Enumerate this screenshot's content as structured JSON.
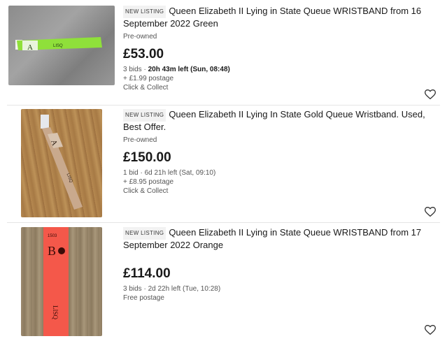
{
  "listings": [
    {
      "badge": "NEW LISTING",
      "title": "Queen Elizabeth II Lying in State Queue WRISTBAND from 16 September 2022  Green",
      "condition": "Pre-owned",
      "price": "£53.00",
      "bids": "3 bids · ",
      "time_left": "20h 43m left (Sun, 08:48)",
      "postage": "+ £1.99 postage",
      "collect": "Click & Collect",
      "band": {
        "color": "#8fe03a",
        "letter": "A",
        "code": "LISQ"
      },
      "watch_icon": "heart-outline-icon"
    },
    {
      "badge": "NEW LISTING",
      "title": "Queen Elizabeth II Lying In State Gold Queue Wristband. Used, Best Offer.",
      "condition": "Pre-owned",
      "price": "£150.00",
      "bids": "1 bid · 6d 21h left (Sat, 09:10)",
      "postage": "+ £8.95 postage",
      "collect": "Click & Collect",
      "band": {
        "color": "#c9a98d",
        "letter": "A",
        "code": "LISQ"
      },
      "watch_icon": "heart-outline-icon"
    },
    {
      "badge": "NEW LISTING",
      "title": "Queen Elizabeth II Lying in State Queue WRISTBAND from 17 September 2022 Orange",
      "price": "£114.00",
      "bids": "3 bids · 2d 22h left (Tue, 10:28)",
      "postage": "Free postage",
      "band": {
        "color": "#f4584a",
        "letter": "B",
        "code": "LISQ"
      },
      "watch_icon": "heart-outline-icon"
    }
  ]
}
